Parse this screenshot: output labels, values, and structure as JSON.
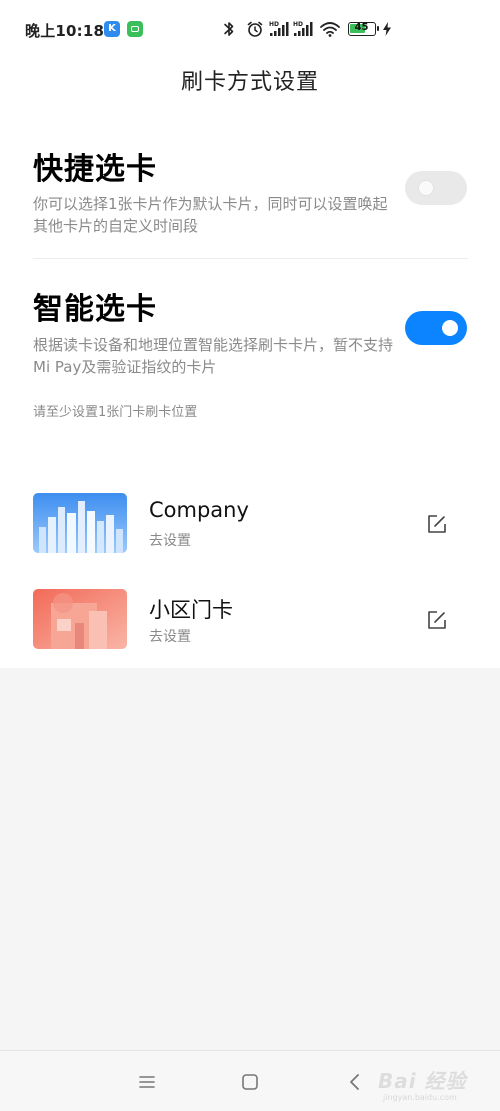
{
  "status_bar": {
    "time": "晚上10:18",
    "battery_level": "45",
    "icons": [
      "app-k-icon",
      "app-wechat-icon",
      "bluetooth-icon",
      "alarm-icon",
      "signal-hd-icon",
      "signal-hd-icon",
      "wifi-icon",
      "battery-icon",
      "charging-icon"
    ]
  },
  "header": {
    "title": "刷卡方式设置"
  },
  "quick_select": {
    "title": "快捷选卡",
    "description": "你可以选择1张卡片作为默认卡片，同时可以设置唤起其他卡片的自定义时间段",
    "enabled": false
  },
  "smart_select": {
    "title": "智能选卡",
    "description": "根据读卡设备和地理位置智能选择刷卡卡片，暂不支持Mi Pay及需验证指纹的卡片",
    "enabled": true,
    "hint": "请至少设置1张门卡刷卡位置"
  },
  "cards": [
    {
      "name": "Company",
      "action": "去设置",
      "thumb_color": "#4a9bf0"
    },
    {
      "name": "小区门卡",
      "action": "去设置",
      "thumb_color": "#f08a78"
    }
  ],
  "colors": {
    "accent": "#0d84ff",
    "toggle_off": "#e9e9e9",
    "secondary_text": "#8a8a8a"
  },
  "nav": {
    "buttons": [
      "menu-icon",
      "home-icon",
      "back-icon"
    ]
  },
  "watermark": {
    "text": "Bai 经验",
    "url": "jingyan.baidu.com"
  }
}
